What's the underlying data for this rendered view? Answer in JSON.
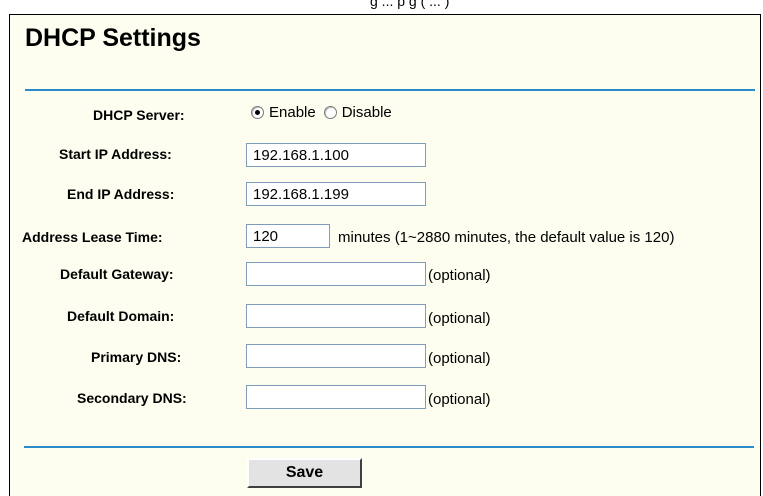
{
  "header": {
    "clipped_text": "g  ...   p g  (   ...   )"
  },
  "page": {
    "title": "DHCP Settings"
  },
  "form": {
    "dhcp_server": {
      "label": "DHCP Server:",
      "options": [
        "Enable",
        "Disable"
      ],
      "selected": "Enable"
    },
    "start_ip": {
      "label": "Start IP Address:",
      "value": "192.168.1.100"
    },
    "end_ip": {
      "label": "End IP Address:",
      "value": "192.168.1.199"
    },
    "lease_time": {
      "label": "Address Lease Time:",
      "value": "120",
      "note": "minutes (1~2880 minutes, the default value is 120)"
    },
    "default_gateway": {
      "label": "Default Gateway:",
      "value": "",
      "note": "(optional)"
    },
    "default_domain": {
      "label": "Default Domain:",
      "value": "",
      "note": "(optional)"
    },
    "primary_dns": {
      "label": "Primary DNS:",
      "value": "",
      "note": "(optional)"
    },
    "secondary_dns": {
      "label": "Secondary DNS:",
      "value": "",
      "note": "(optional)"
    }
  },
  "actions": {
    "save_label": "Save"
  },
  "colors": {
    "accent_rule": "#2b8ac9",
    "panel_bg": "#fdfdf0"
  }
}
